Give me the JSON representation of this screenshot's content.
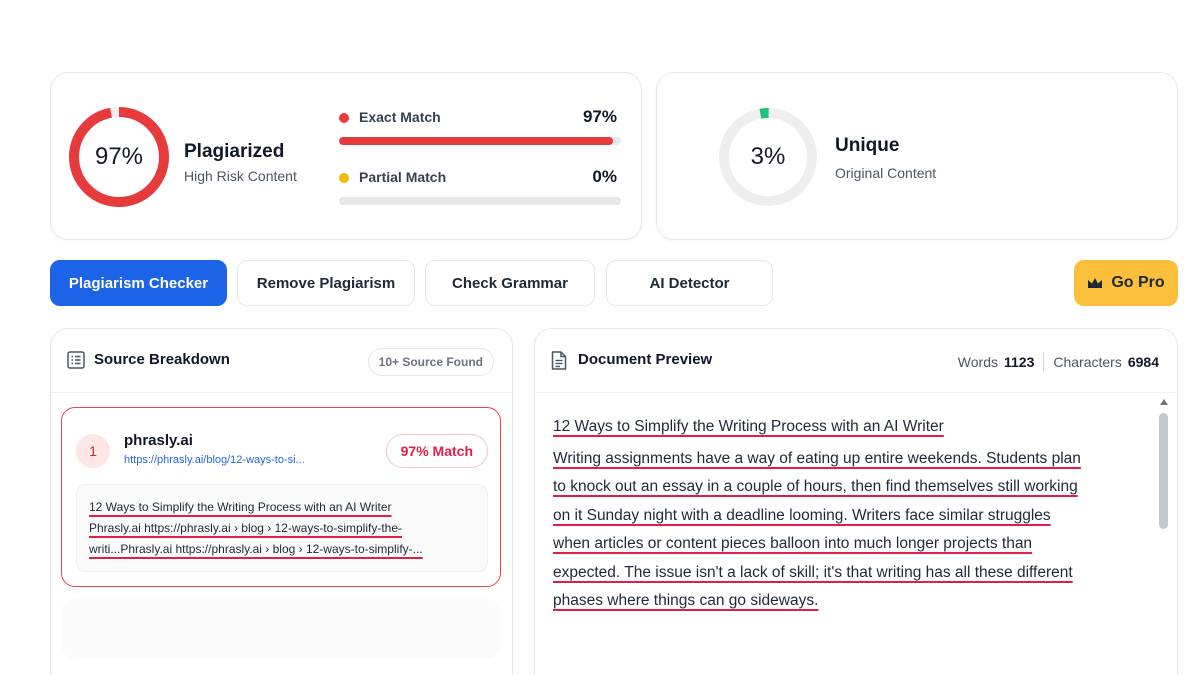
{
  "plagiarism": {
    "percent_label": "97%",
    "fraction": 0.97,
    "title": "Plagiarized",
    "subtitle": "High Risk Content",
    "color": "#e63a3d"
  },
  "matches": {
    "exact": {
      "label": "Exact Match",
      "value": "97%",
      "fraction": 0.97,
      "color": "#e63a3d"
    },
    "partial": {
      "label": "Partial Match",
      "value": "0%",
      "fraction": 0.0,
      "color": "#f5b70f"
    }
  },
  "unique": {
    "percent_label": "3%",
    "fraction": 0.03,
    "title": "Unique",
    "subtitle": "Original Content",
    "color": "#22c17a"
  },
  "tabs": [
    {
      "label": "Plagiarism Checker",
      "active": true
    },
    {
      "label": "Remove Plagiarism",
      "active": false
    },
    {
      "label": "Check Grammar",
      "active": false
    },
    {
      "label": "AI Detector",
      "active": false
    }
  ],
  "go_pro": {
    "label": "Go Pro",
    "icon": "crown-icon"
  },
  "sources": {
    "title": "Source Breakdown",
    "icon": "list-icon",
    "badge": "10+ Source Found",
    "items": [
      {
        "number": "1",
        "name": "phrasly.ai",
        "url": "https://phrasly.ai/blog/12-ways-to-si...",
        "match": "97% Match",
        "snippet_lines": [
          "12 Ways to Simplify the Writing Process with an AI Writer",
          "Phrasly.ai https://phrasly.ai › blog › 12-ways-to-simplify-the-",
          "writi...Phrasly.ai https://phrasly.ai › blog › 12-ways-to-simplify-..."
        ]
      }
    ]
  },
  "document": {
    "title": "Document Preview",
    "icon": "document-icon",
    "words_label": "Words",
    "words": "1123",
    "chars_label": "Characters",
    "chars": "6984",
    "heading": "12 Ways to Simplify the Writing Process with an AI Writer",
    "lines": [
      "Writing assignments have a way of eating up entire weekends. Students plan",
      "to knock out an essay in a couple of hours, then find themselves still working",
      "on it Sunday night with a deadline looming. Writers face similar struggles",
      "when articles or content pieces balloon into much longer projects than",
      "expected. The issue isn't a lack of skill; it's that writing has all these different",
      "phases where things can go sideways."
    ]
  }
}
